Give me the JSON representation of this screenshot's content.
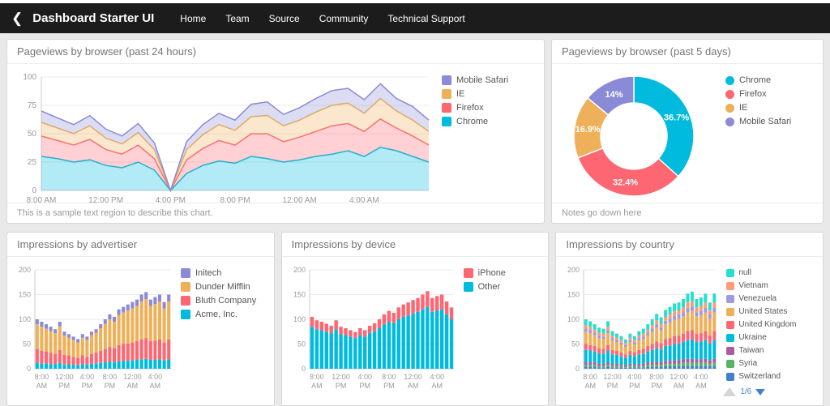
{
  "navbar": {
    "title": "Dashboard Starter UI",
    "items": [
      {
        "label": "Home"
      },
      {
        "label": "Team"
      },
      {
        "label": "Source"
      },
      {
        "label": "Community"
      },
      {
        "label": "Technical Support"
      }
    ]
  },
  "panels": {
    "area_note": "This is a sample text region to describe this chart.",
    "donut_note": "Notes go down here",
    "country_pagination": "1/6"
  },
  "chart_data": [
    {
      "id": "pageviews-24h",
      "type": "area",
      "title": "Pageviews by browser (past 24 hours)",
      "stacked": true,
      "ymax": 100,
      "yticks": [
        0,
        25,
        50,
        75,
        100
      ],
      "x_labels": [
        "8:00 AM",
        "12:00 PM",
        "4:00 PM",
        "8:00 PM",
        "12:00 AM",
        "4:00 AM"
      ],
      "label_pos": [
        0,
        4,
        8,
        12,
        16,
        20
      ],
      "series": [
        {
          "name": "Chrome",
          "color": "#00bbde",
          "values": [
            30,
            28,
            25,
            27,
            22,
            20,
            25,
            18,
            0,
            15,
            22,
            26,
            24,
            30,
            28,
            25,
            27,
            30,
            32,
            35,
            30,
            38,
            35,
            30,
            25
          ]
        },
        {
          "name": "Firefox",
          "color": "#fe6672",
          "values": [
            18,
            16,
            15,
            18,
            14,
            12,
            15,
            10,
            0,
            12,
            15,
            18,
            16,
            20,
            22,
            18,
            20,
            22,
            25,
            24,
            22,
            25,
            20,
            18,
            15
          ]
        },
        {
          "name": "IE",
          "color": "#eeb058",
          "values": [
            12,
            11,
            10,
            12,
            10,
            9,
            11,
            8,
            0,
            9,
            12,
            14,
            13,
            15,
            16,
            14,
            15,
            17,
            18,
            18,
            16,
            18,
            15,
            14,
            12
          ]
        },
        {
          "name": "Mobile Safari",
          "color": "#8a8ad6",
          "values": [
            10,
            9,
            8,
            9,
            8,
            7,
            8,
            6,
            0,
            7,
            9,
            10,
            9,
            11,
            12,
            10,
            11,
            12,
            13,
            13,
            12,
            13,
            11,
            12,
            10
          ]
        }
      ],
      "legend_position": "right"
    },
    {
      "id": "pageviews-5d",
      "type": "pie",
      "title": "Pageviews by browser (past 5 days)",
      "slices": [
        {
          "name": "Chrome",
          "color": "#00bbde",
          "value": 36.7,
          "label": "36.7%"
        },
        {
          "name": "Firefox",
          "color": "#fe6672",
          "value": 32.4,
          "label": "32.4%"
        },
        {
          "name": "IE",
          "color": "#eeb058",
          "value": 16.9,
          "label": "16.9%"
        },
        {
          "name": "Mobile Safari",
          "color": "#8a8ad6",
          "value": 14.0,
          "label": "14%"
        }
      ],
      "legend_position": "right"
    },
    {
      "id": "impressions-advertiser",
      "type": "bar",
      "title": "Impressions by advertiser",
      "stacked": true,
      "ymax": 200,
      "yticks": [
        0,
        50,
        100,
        150,
        200
      ],
      "x_labels": [
        [
          "8:00",
          "AM"
        ],
        [
          "12:00",
          "PM"
        ],
        [
          "4:00",
          "PM"
        ],
        [
          "8:00",
          "PM"
        ],
        [
          "12:00",
          "AM"
        ],
        [
          "4:00",
          "AM"
        ]
      ],
      "label_indices": [
        1,
        6,
        11,
        16,
        21,
        26
      ],
      "series": [
        {
          "name": "Acme, Inc.",
          "color": "#00bbde",
          "values": [
            12,
            10,
            11,
            9,
            10,
            12,
            8,
            9,
            8,
            7,
            9,
            8,
            10,
            11,
            12,
            13,
            14,
            13,
            15,
            16,
            16,
            17,
            18,
            19,
            20,
            18,
            18,
            19,
            17,
            19
          ]
        },
        {
          "name": "Bluth Company",
          "color": "#fe6672",
          "values": [
            28,
            26,
            24,
            23,
            20,
            26,
            20,
            18,
            16,
            15,
            18,
            16,
            20,
            22,
            24,
            27,
            30,
            28,
            33,
            34,
            35,
            36,
            38,
            40,
            42,
            38,
            39,
            40,
            36,
            40
          ]
        },
        {
          "name": "Dunder Mifflin",
          "color": "#eeb058",
          "values": [
            50,
            49,
            46,
            44,
            42,
            48,
            39,
            36,
            34,
            31,
            36,
            34,
            38,
            40,
            46,
            51,
            56,
            54,
            61,
            64,
            67,
            69,
            71,
            77,
            79,
            71,
            74,
            77,
            69,
            77
          ]
        },
        {
          "name": "Initech",
          "color": "#8a8ad6",
          "values": [
            10,
            10,
            9,
            9,
            8,
            9,
            8,
            7,
            7,
            7,
            7,
            7,
            7,
            7,
            8,
            9,
            10,
            10,
            11,
            11,
            12,
            13,
            13,
            14,
            14,
            13,
            14,
            14,
            13,
            14
          ]
        }
      ],
      "legend_position": "right"
    },
    {
      "id": "impressions-device",
      "type": "bar",
      "title": "Impressions by device",
      "stacked": true,
      "ymax": 200,
      "yticks": [
        0,
        50,
        100,
        150,
        200
      ],
      "x_labels": [
        [
          "8:00",
          "AM"
        ],
        [
          "12:00",
          "PM"
        ],
        [
          "4:00",
          "PM"
        ],
        [
          "8:00",
          "PM"
        ],
        [
          "12:00",
          "AM"
        ],
        [
          "4:00",
          "AM"
        ]
      ],
      "label_indices": [
        1,
        6,
        11,
        16,
        21,
        26
      ],
      "series": [
        {
          "name": "Other",
          "color": "#00bbde",
          "values": [
            85,
            80,
            78,
            75,
            72,
            80,
            70,
            68,
            65,
            62,
            68,
            65,
            72,
            76,
            82,
            90,
            95,
            92,
            100,
            105,
            108,
            112,
            115,
            120,
            125,
            115,
            118,
            120,
            110,
            100
          ]
        },
        {
          "name": "iPhone",
          "color": "#fe6672",
          "values": [
            20,
            18,
            17,
            16,
            15,
            18,
            15,
            14,
            13,
            12,
            14,
            13,
            15,
            16,
            18,
            20,
            22,
            21,
            24,
            25,
            26,
            27,
            28,
            30,
            32,
            28,
            29,
            30,
            26,
            24
          ]
        }
      ],
      "legend_position": "right"
    },
    {
      "id": "impressions-country",
      "type": "bar",
      "title": "Impressions by country",
      "stacked": true,
      "ymax": 200,
      "yticks": [
        0,
        50,
        100,
        150,
        200
      ],
      "x_labels": [
        [
          "8:00",
          "AM"
        ],
        [
          "12:00",
          "PM"
        ],
        [
          "4:00",
          "PM"
        ],
        [
          "8:00",
          "PM"
        ],
        [
          "12:00",
          "AM"
        ],
        [
          "4:00",
          "AM"
        ]
      ],
      "label_indices": [
        1,
        6,
        11,
        16,
        21,
        26
      ],
      "series": [
        {
          "name": "Switzerland",
          "color": "#4281c9",
          "values": [
            4,
            4,
            4,
            3,
            3,
            4,
            3,
            3,
            3,
            2,
            3,
            3,
            3,
            3,
            4,
            4,
            4,
            4,
            5,
            5,
            5,
            5,
            6,
            6,
            6,
            6,
            6,
            6,
            5,
            6
          ]
        },
        {
          "name": "Syria",
          "color": "#57b566",
          "values": [
            4,
            4,
            4,
            3,
            3,
            4,
            3,
            3,
            3,
            2,
            3,
            3,
            3,
            3,
            4,
            4,
            4,
            4,
            5,
            5,
            5,
            5,
            6,
            6,
            6,
            6,
            6,
            6,
            5,
            6
          ]
        },
        {
          "name": "Taiwan",
          "color": "#ac5c9e",
          "values": [
            5,
            5,
            5,
            4,
            4,
            5,
            4,
            4,
            3,
            3,
            4,
            3,
            4,
            4,
            5,
            5,
            6,
            5,
            6,
            6,
            7,
            7,
            7,
            8,
            8,
            7,
            7,
            8,
            7,
            8
          ]
        },
        {
          "name": "Ukraine",
          "color": "#00bbde",
          "values": [
            25,
            24,
            22,
            21,
            20,
            24,
            19,
            18,
            16,
            15,
            18,
            16,
            19,
            20,
            22,
            25,
            28,
            26,
            30,
            31,
            33,
            34,
            35,
            38,
            39,
            35,
            36,
            38,
            34,
            38
          ]
        },
        {
          "name": "United Kingdom",
          "color": "#fe6672",
          "values": [
            12,
            11,
            11,
            10,
            10,
            11,
            9,
            8,
            8,
            7,
            8,
            8,
            9,
            10,
            11,
            12,
            13,
            13,
            14,
            15,
            16,
            16,
            17,
            18,
            19,
            17,
            17,
            18,
            16,
            18
          ]
        },
        {
          "name": "United States",
          "color": "#eeb058",
          "values": [
            25,
            24,
            22,
            21,
            20,
            24,
            19,
            18,
            16,
            15,
            18,
            16,
            19,
            20,
            22,
            25,
            28,
            26,
            30,
            31,
            33,
            34,
            35,
            38,
            39,
            35,
            36,
            38,
            34,
            38
          ]
        },
        {
          "name": "Venezuela",
          "color": "#9b9be1",
          "values": [
            6,
            6,
            5,
            5,
            5,
            6,
            5,
            4,
            4,
            4,
            4,
            4,
            5,
            5,
            5,
            6,
            7,
            6,
            7,
            8,
            8,
            8,
            8,
            9,
            9,
            8,
            9,
            9,
            8,
            9
          ]
        },
        {
          "name": "Vietnam",
          "color": "#ff9b79",
          "values": [
            7,
            7,
            6,
            6,
            6,
            7,
            5,
            5,
            5,
            4,
            5,
            5,
            5,
            6,
            6,
            7,
            8,
            7,
            8,
            9,
            9,
            9,
            10,
            11,
            11,
            10,
            10,
            11,
            9,
            11
          ]
        },
        {
          "name": "null",
          "color": "#26dfcd",
          "values": [
            12,
            11,
            11,
            10,
            10,
            11,
            9,
            8,
            8,
            7,
            8,
            8,
            9,
            10,
            11,
            12,
            13,
            13,
            14,
            15,
            16,
            16,
            17,
            18,
            19,
            17,
            17,
            18,
            16,
            18
          ]
        }
      ],
      "legend_position": "right"
    }
  ]
}
